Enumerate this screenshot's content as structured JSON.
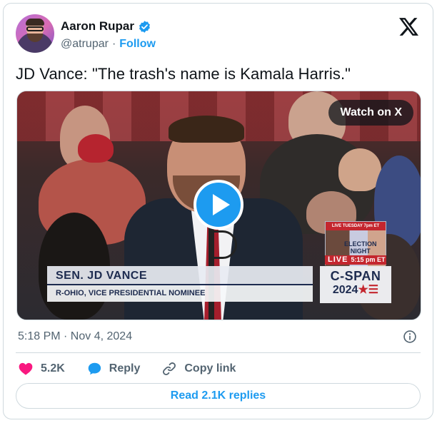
{
  "author": {
    "name": "Aaron Rupar",
    "handle": "@atrupar",
    "separator": "·",
    "follow_label": "Follow",
    "verified": true
  },
  "tweet": {
    "text": "JD Vance: \"The trash's name is Kamala Harris.\"",
    "timestamp": "5:18 PM · Nov 4, 2024"
  },
  "video": {
    "watch_label": "Watch on X",
    "lower_third": {
      "name": "SEN. JD VANCE",
      "title": "R-OHIO, VICE PRESIDENTIAL NOMINEE"
    },
    "promo": {
      "top": "LIVE TUESDAY 7pm ET",
      "headline_1": "ELECTION",
      "headline_2": "NIGHT"
    },
    "live": {
      "label": "LIVE",
      "time": "5:15 pm ET"
    },
    "network": {
      "line1": "C-SPAN",
      "line2_year": "2024",
      "line2_mark": "★☰"
    }
  },
  "actions": {
    "likes": "5.2K",
    "reply_label": "Reply",
    "copy_label": "Copy link"
  },
  "replies_button": "Read 2.1K replies",
  "colors": {
    "accent": "#1d9bf0",
    "like": "#f91880",
    "text": "#0f1419",
    "muted": "#536471",
    "border": "#cfd9de"
  },
  "icons": [
    "verified-badge-icon",
    "x-logo-icon",
    "play-icon",
    "info-icon",
    "heart-icon",
    "reply-icon",
    "link-icon"
  ]
}
